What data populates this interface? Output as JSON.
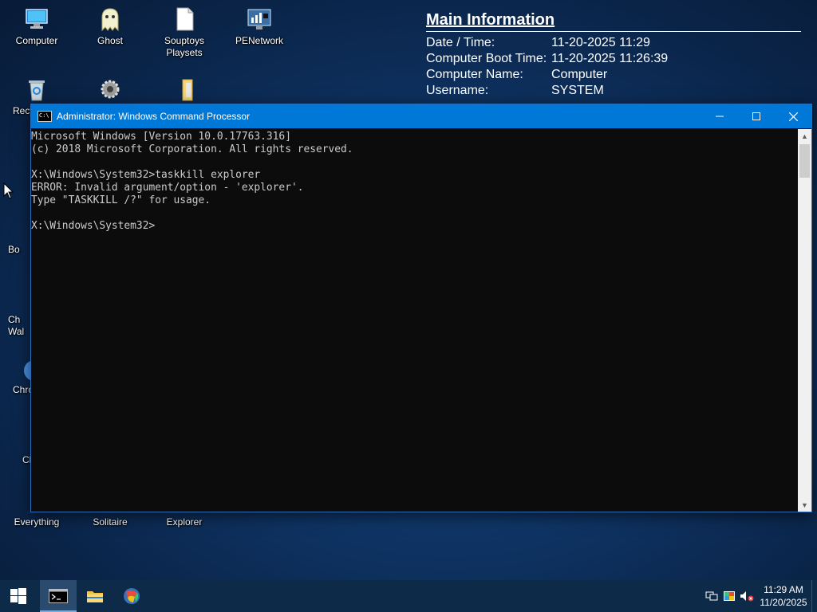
{
  "info_panel": {
    "title": "Main Information",
    "rows": [
      {
        "key": "Date / Time:",
        "value": "11-20-2025 11:29"
      },
      {
        "key": "Computer Boot Time:",
        "value": "11-20-2025 11:26:39"
      },
      {
        "key": "Computer Name:",
        "value": "Computer"
      },
      {
        "key": "Username:",
        "value": "SYSTEM"
      }
    ]
  },
  "desktop_icons": {
    "computer": "Computer",
    "ghost": "Ghost",
    "souptoys": "Souptoys Playsets",
    "penetwork": "PENetwork",
    "recycle": "Recy",
    "bo": "Bo",
    "ch_wal": "Ch Wal",
    "chro": "Chro",
    "cl": "Cl",
    "everything": "Everything",
    "solitaire": "Solitaire",
    "explorer": "Explorer"
  },
  "cmd_window": {
    "title": "Administrator: Windows Command Processor",
    "lines": [
      "Microsoft Windows [Version 10.0.17763.316]",
      "(c) 2018 Microsoft Corporation. All rights reserved.",
      "",
      "X:\\Windows\\System32>taskkill explorer",
      "ERROR: Invalid argument/option - 'explorer'.",
      "Type \"TASKKILL /?\" for usage.",
      "",
      "X:\\Windows\\System32>"
    ]
  },
  "taskbar": {
    "time": "11:29 AM",
    "date": "11/20/2025"
  },
  "colors": {
    "taskbar": "#0e2a49",
    "titlebar": "#0078d7",
    "console_bg": "#0c0c0c",
    "console_text": "#cccccc"
  }
}
